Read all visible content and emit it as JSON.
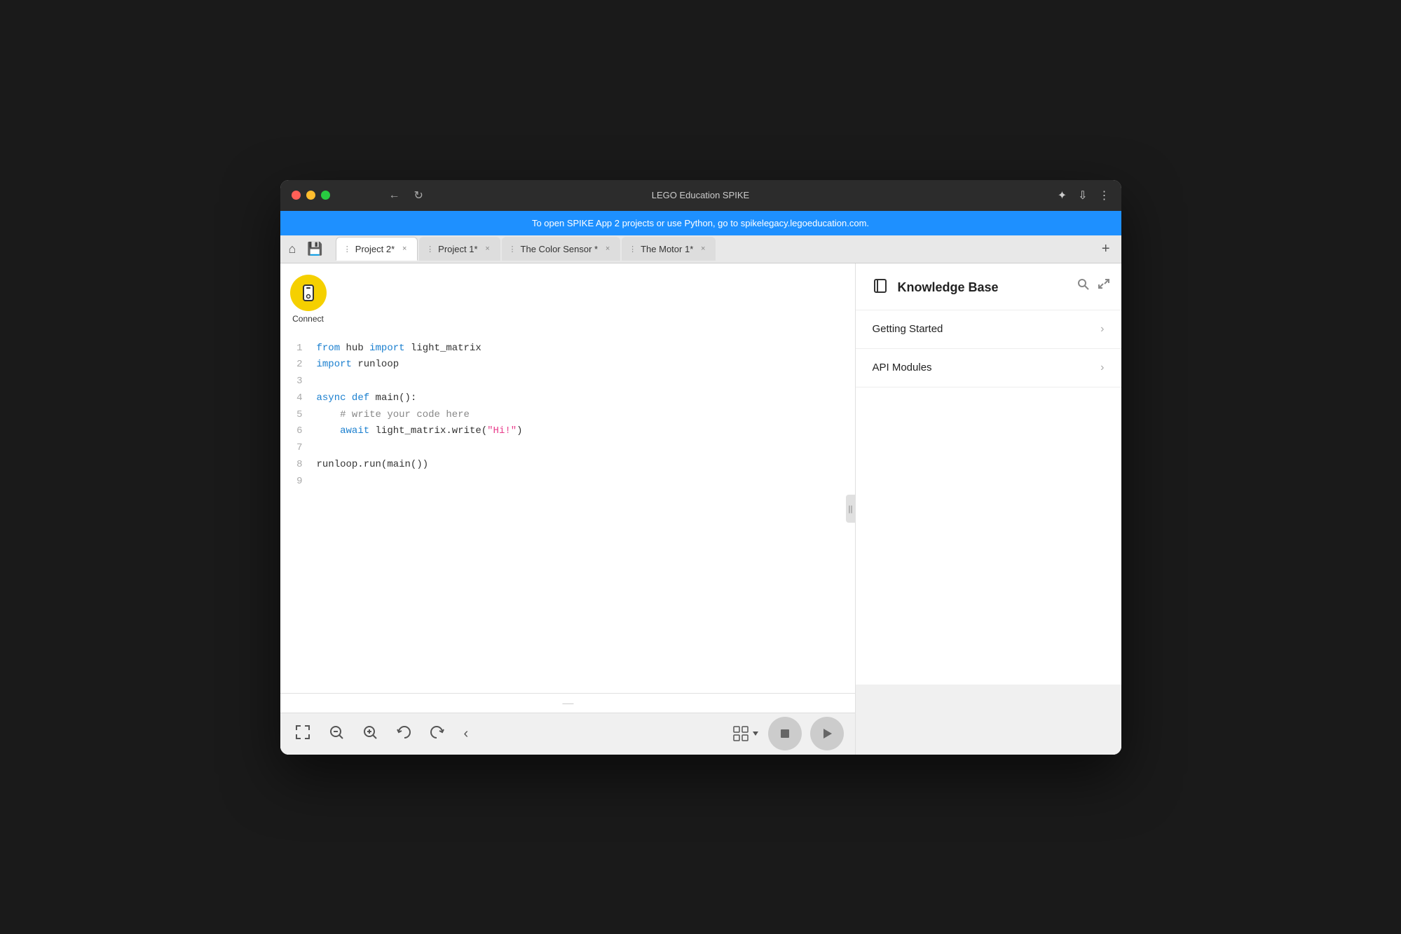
{
  "window": {
    "title": "LEGO Education SPIKE"
  },
  "banner": {
    "text": "To open SPIKE App 2 projects or use Python, go to spikelegacy.legoeducation.com."
  },
  "tabs": [
    {
      "label": "Project 2*",
      "active": true
    },
    {
      "label": "Project 1*",
      "active": false
    },
    {
      "label": "The Color Sensor *",
      "active": false
    },
    {
      "label": "The Motor 1*",
      "active": false
    }
  ],
  "connect": {
    "label": "Connect"
  },
  "code": {
    "lines": [
      {
        "num": "1",
        "content": "from hub import light_matrix"
      },
      {
        "num": "2",
        "content": "import runloop"
      },
      {
        "num": "3",
        "content": ""
      },
      {
        "num": "4",
        "content": "async def main():"
      },
      {
        "num": "5",
        "content": "    # write your code here"
      },
      {
        "num": "6",
        "content": "    await light_matrix.write(\"Hi!\")"
      },
      {
        "num": "7",
        "content": ""
      },
      {
        "num": "8",
        "content": "runloop.run(main())"
      },
      {
        "num": "9",
        "content": ""
      }
    ]
  },
  "knowledge_base": {
    "title": "Knowledge Base",
    "items": [
      {
        "label": "Getting Started"
      },
      {
        "label": "API Modules"
      }
    ]
  },
  "toolbar": {
    "fullscreen_label": "⤢",
    "zoom_out_label": "−",
    "zoom_in_label": "+",
    "undo_label": "↺",
    "redo_label": "↻",
    "collapse_label": "‹",
    "stop_label": "■",
    "play_label": "▶"
  }
}
